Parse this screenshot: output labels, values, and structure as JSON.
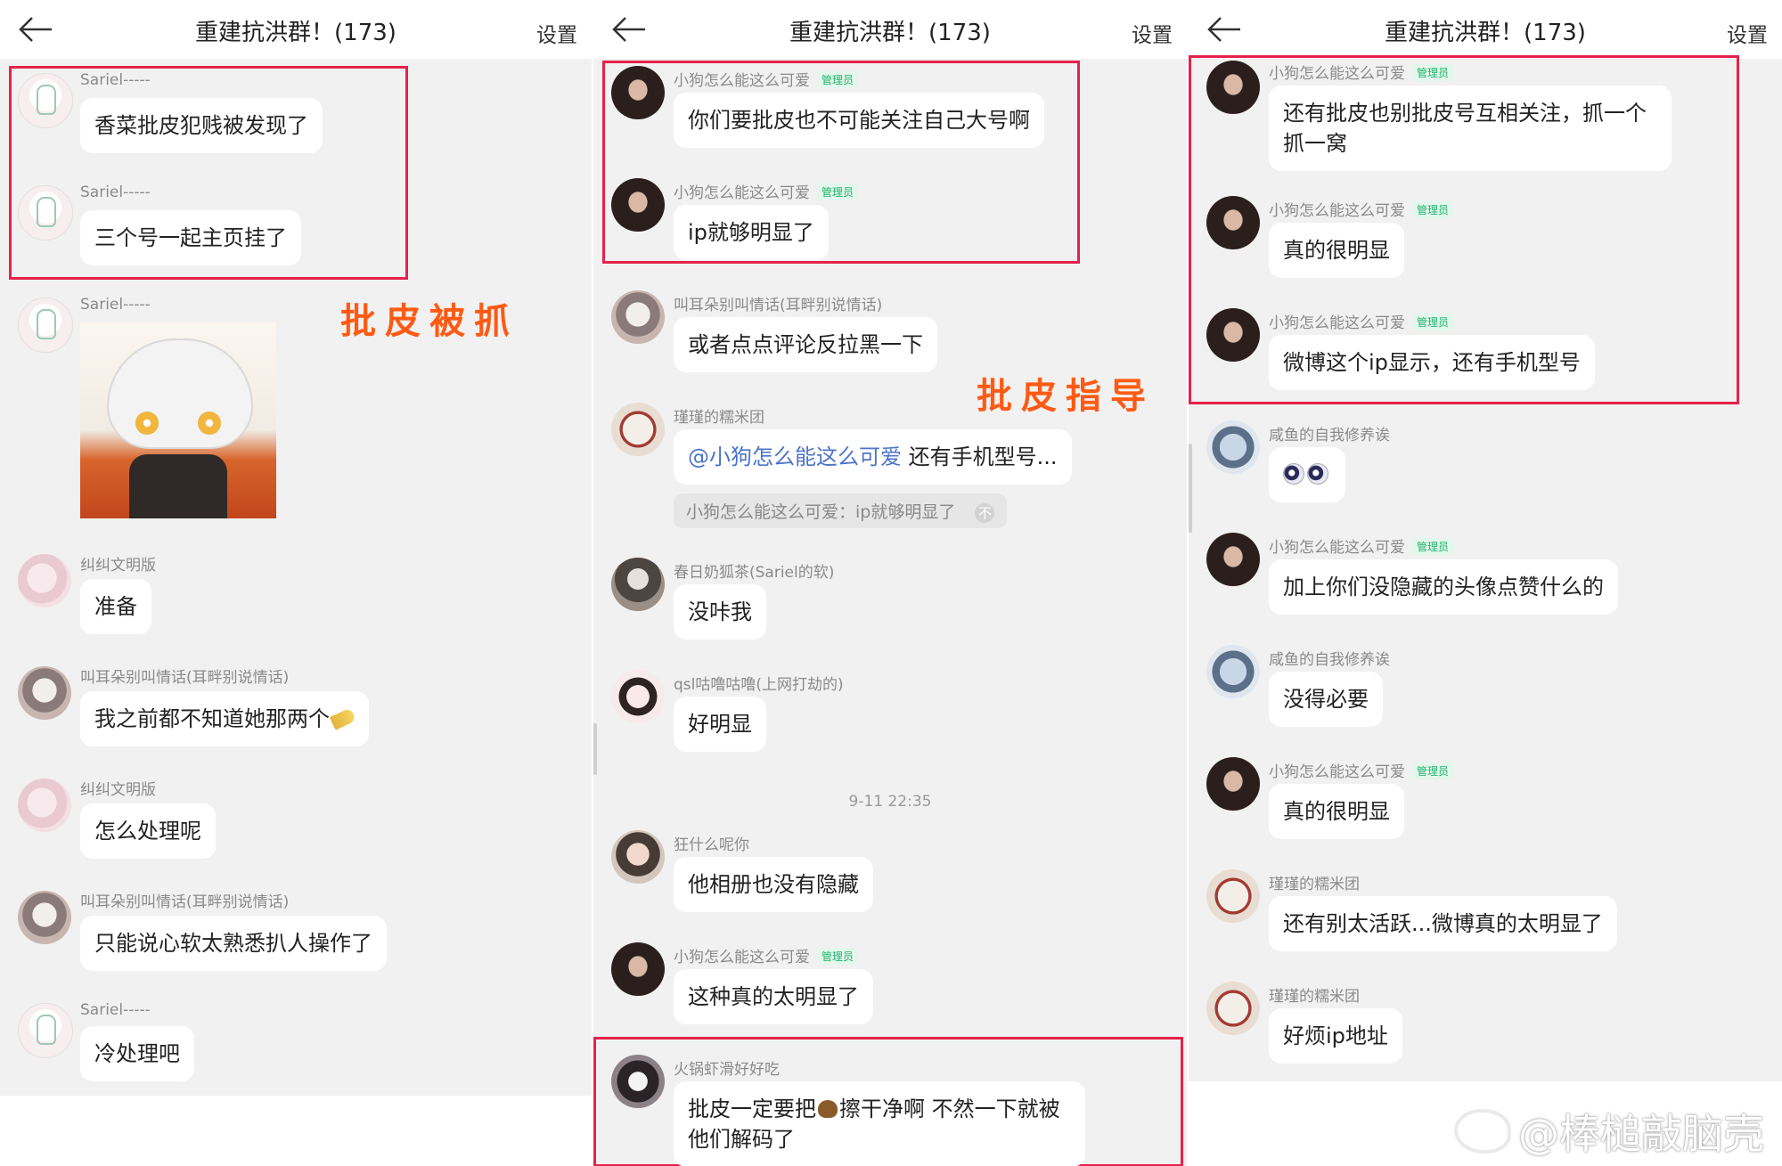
{
  "header": {
    "title": "重建抗洪群！(173)",
    "settings": "设置"
  },
  "overlays": {
    "p1": "批皮被抓",
    "p2": "批皮指导"
  },
  "watermark": "@棒槌敲脑壳",
  "badge": "管理员",
  "panel1": {
    "messages": [
      {
        "name": "Sariel-----",
        "text": "香菜批皮犯贱被发现了"
      },
      {
        "name": "Sariel-----",
        "text": "三个号一起主页挂了"
      },
      {
        "name": "Sariel-----",
        "text": ""
      },
      {
        "name": "纠纠文明版",
        "text": "准备"
      },
      {
        "name": "叫耳朵别叫情话(耳畔别说情话)",
        "text": "我之前都不知道她那两个"
      },
      {
        "name": "纠纠文明版",
        "text": "怎么处理呢"
      },
      {
        "name": "叫耳朵别叫情话(耳畔别说情话)",
        "text": "只能说心软太熟悉扒人操作了"
      },
      {
        "name": "Sariel-----",
        "text": "冷处理吧"
      }
    ]
  },
  "panel2": {
    "timestamp": "9-11 22:35",
    "messages": [
      {
        "name": "小狗怎么能这么可爱",
        "text": "你们要批皮也不可能关注自己大号啊"
      },
      {
        "name": "小狗怎么能这么可爱",
        "text": "ip就够明显了"
      },
      {
        "name": "叫耳朵别叫情话(耳畔别说情话)",
        "text": "或者点点评论反拉黑一下"
      },
      {
        "name": "瑾瑾的糯米团",
        "mention": "@小狗怎么能这么可爱",
        "text": " 还有手机型号...",
        "quote": "小狗怎么能这么可爱：ip就够明显了",
        "quote_arrow": "不"
      },
      {
        "name": "春日奶狐茶(Sariel的软)",
        "text": "没咔我"
      },
      {
        "name": "qsl咕噜咕噜(上网打劫的)",
        "text": "好明显"
      },
      {
        "name": "狂什么呢你",
        "text": "他相册也没有隐藏"
      },
      {
        "name": "小狗怎么能这么可爱",
        "text": "这种真的太明显了"
      },
      {
        "name": "火锅虾滑好好吃",
        "text_a": "批皮一定要把",
        "text_b": "擦干净啊 不然一下就被他们解码了"
      }
    ]
  },
  "panel3": {
    "messages": [
      {
        "name": "小狗怎么能这么可爱",
        "text": "还有批皮也别批皮号互相关注，抓一个抓一窝"
      },
      {
        "name": "小狗怎么能这么可爱",
        "text": "真的很明显"
      },
      {
        "name": "小狗怎么能这么可爱",
        "text": "微博这个ip显示，还有手机型号"
      },
      {
        "name": "咸鱼的自我修养诶",
        "text": ""
      },
      {
        "name": "小狗怎么能这么可爱",
        "text": "加上你们没隐藏的头像点赞什么的"
      },
      {
        "name": "咸鱼的自我修养诶",
        "text": "没得必要"
      },
      {
        "name": "小狗怎么能这么可爱",
        "text": "真的很明显"
      },
      {
        "name": "瑾瑾的糯米团",
        "text": "还有别太活跃...微博真的太明显了"
      },
      {
        "name": "瑾瑾的糯米团",
        "text": "好烦ip地址"
      }
    ]
  }
}
